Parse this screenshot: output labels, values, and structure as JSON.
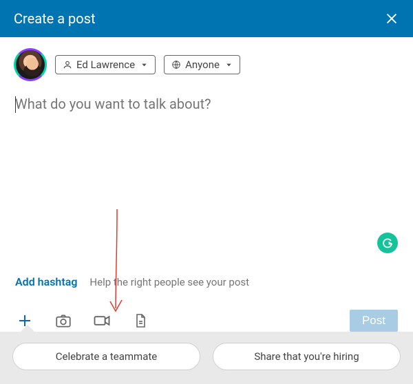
{
  "header": {
    "title": "Create a post"
  },
  "author": {
    "name": "Ed Lawrence"
  },
  "visibility": {
    "label": "Anyone"
  },
  "compose": {
    "placeholder": "What do you want to talk about?"
  },
  "hashtag": {
    "link_label": "Add hashtag",
    "hint": "Help the right people see your post"
  },
  "buttons": {
    "post": "Post"
  },
  "suggestions": {
    "celebrate": "Celebrate a teammate",
    "hiring": "Share that you're hiring"
  },
  "icons": {
    "close": "close-icon",
    "person": "person-icon",
    "globe": "globe-icon",
    "plus": "plus-icon",
    "camera": "camera-icon",
    "video": "video-icon",
    "document": "document-icon",
    "grammarly": "grammarly-icon"
  },
  "colors": {
    "brand_blue": "#0073b1",
    "post_disabled": "#a7cce4",
    "grammarly_green": "#15c39a"
  }
}
